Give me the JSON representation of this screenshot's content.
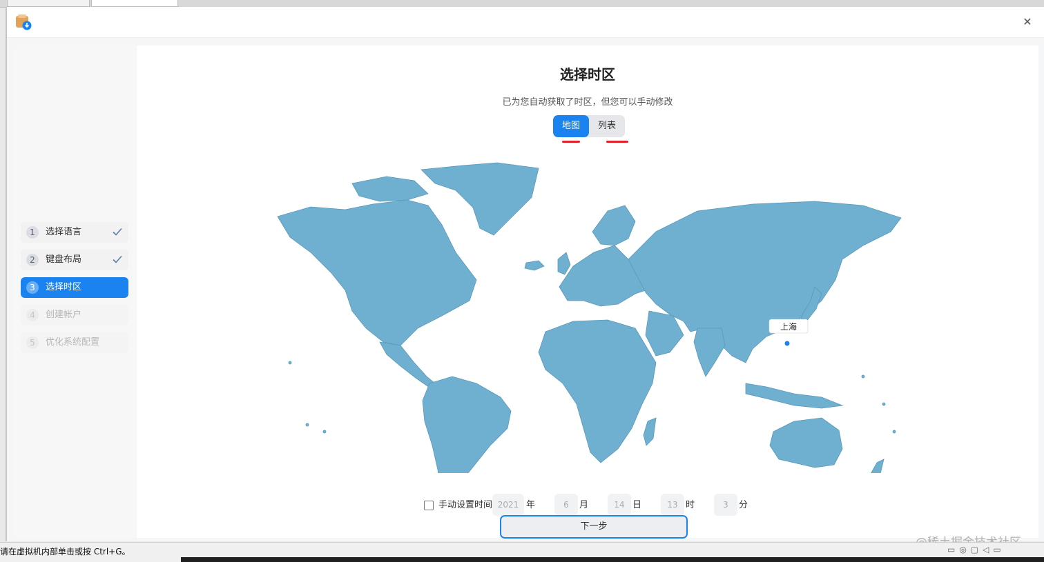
{
  "window": {
    "close_glyph": "✕"
  },
  "steps": [
    {
      "num": "1",
      "label": "选择语言",
      "state": "done"
    },
    {
      "num": "2",
      "label": "键盘布局",
      "state": "done"
    },
    {
      "num": "3",
      "label": "选择时区",
      "state": "active"
    },
    {
      "num": "4",
      "label": "创建帐户",
      "state": "disabled"
    },
    {
      "num": "5",
      "label": "优化系统配置",
      "state": "disabled"
    }
  ],
  "main": {
    "title": "选择时区",
    "subtitle": "已为您自动获取了时区，但您可以手动修改",
    "tabs": {
      "map": "地图",
      "list": "列表",
      "selected": "map"
    },
    "map": {
      "city_label": "上海",
      "land_color": "#6fb0d1"
    }
  },
  "time": {
    "manual_label": "手动设置时间",
    "manual_checked": false,
    "year": "2021",
    "year_unit": "年",
    "month": "6",
    "month_unit": "月",
    "day": "14",
    "day_unit": "日",
    "hour": "13",
    "hour_unit": "时",
    "minute": "3",
    "minute_unit": "分"
  },
  "next_label": "下一步",
  "status_message": "请在虚拟机内部单击或按 Ctrl+G。",
  "watermark": "@稀土掘金技术社区",
  "colors": {
    "accent": "#1a83f0",
    "underline": "#e0202a"
  }
}
